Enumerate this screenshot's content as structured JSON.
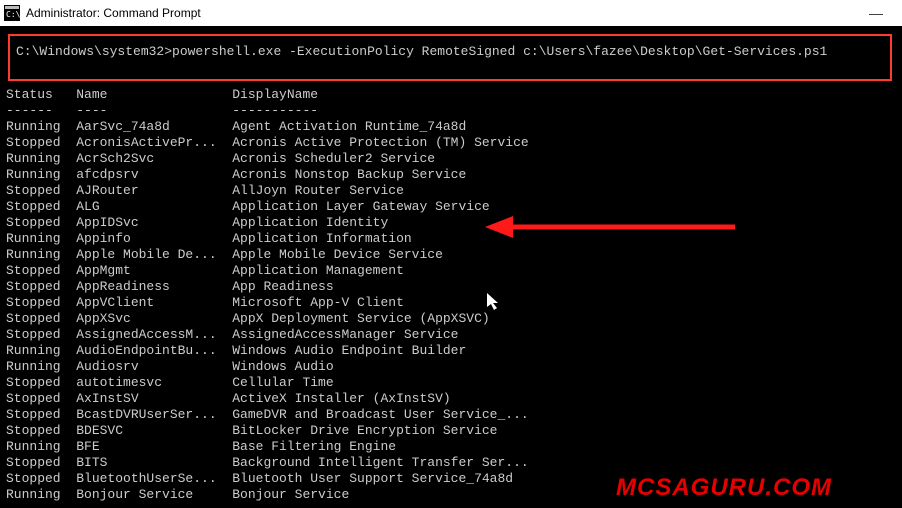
{
  "window": {
    "title": "Administrator: Command Prompt",
    "min": "—"
  },
  "cmd": {
    "prompt": "C:\\Windows\\system32>",
    "command": "powershell.exe -ExecutionPolicy RemoteSigned c:\\Users\\fazee\\Desktop\\Get-Services.ps1"
  },
  "headers": {
    "status": "Status",
    "name": "Name",
    "display": "DisplayName"
  },
  "dashes": {
    "status": "------",
    "name": "----",
    "display": "-----------"
  },
  "services": [
    {
      "status": "Running",
      "name": "AarSvc_74a8d",
      "display": "Agent Activation Runtime_74a8d"
    },
    {
      "status": "Stopped",
      "name": "AcronisActivePr...",
      "display": "Acronis Active Protection (TM) Service"
    },
    {
      "status": "Running",
      "name": "AcrSch2Svc",
      "display": "Acronis Scheduler2 Service"
    },
    {
      "status": "Running",
      "name": "afcdpsrv",
      "display": "Acronis Nonstop Backup Service"
    },
    {
      "status": "Stopped",
      "name": "AJRouter",
      "display": "AllJoyn Router Service"
    },
    {
      "status": "Stopped",
      "name": "ALG",
      "display": "Application Layer Gateway Service"
    },
    {
      "status": "Stopped",
      "name": "AppIDSvc",
      "display": "Application Identity"
    },
    {
      "status": "Running",
      "name": "Appinfo",
      "display": "Application Information"
    },
    {
      "status": "Running",
      "name": "Apple Mobile De...",
      "display": "Apple Mobile Device Service"
    },
    {
      "status": "Stopped",
      "name": "AppMgmt",
      "display": "Application Management"
    },
    {
      "status": "Stopped",
      "name": "AppReadiness",
      "display": "App Readiness"
    },
    {
      "status": "Stopped",
      "name": "AppVClient",
      "display": "Microsoft App-V Client"
    },
    {
      "status": "Stopped",
      "name": "AppXSvc",
      "display": "AppX Deployment Service (AppXSVC)"
    },
    {
      "status": "Stopped",
      "name": "AssignedAccessM...",
      "display": "AssignedAccessManager Service"
    },
    {
      "status": "Running",
      "name": "AudioEndpointBu...",
      "display": "Windows Audio Endpoint Builder"
    },
    {
      "status": "Running",
      "name": "Audiosrv",
      "display": "Windows Audio"
    },
    {
      "status": "Stopped",
      "name": "autotimesvc",
      "display": "Cellular Time"
    },
    {
      "status": "Stopped",
      "name": "AxInstSV",
      "display": "ActiveX Installer (AxInstSV)"
    },
    {
      "status": "Stopped",
      "name": "BcastDVRUserSer...",
      "display": "GameDVR and Broadcast User Service_..."
    },
    {
      "status": "Stopped",
      "name": "BDESVC",
      "display": "BitLocker Drive Encryption Service"
    },
    {
      "status": "Running",
      "name": "BFE",
      "display": "Base Filtering Engine"
    },
    {
      "status": "Stopped",
      "name": "BITS",
      "display": "Background Intelligent Transfer Ser..."
    },
    {
      "status": "Stopped",
      "name": "BluetoothUserSe...",
      "display": "Bluetooth User Support Service_74a8d"
    },
    {
      "status": "Running",
      "name": "Bonjour Service",
      "display": "Bonjour Service"
    }
  ],
  "watermark": "MCSAGURU.COM"
}
